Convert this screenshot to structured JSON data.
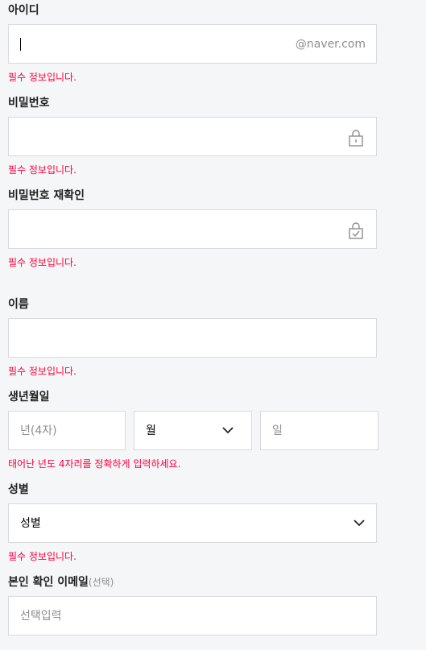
{
  "id_field": {
    "label": "아이디",
    "suffix": "@naver.com",
    "error": "필수 정보입니다."
  },
  "password_field": {
    "label": "비밀번호",
    "icon": "lock-icon",
    "error": "필수 정보입니다."
  },
  "password_confirm_field": {
    "label": "비밀번호 재확인",
    "icon": "lock-check-icon",
    "error": "필수 정보입니다."
  },
  "name_field": {
    "label": "이름",
    "error": "필수 정보입니다."
  },
  "birth_field": {
    "label": "생년월일",
    "year_placeholder": "년(4자)",
    "month_value": "월",
    "day_placeholder": "일",
    "error": "태어난 년도 4자리를 정확하게 입력하세요."
  },
  "gender_field": {
    "label": "성별",
    "value": "성별",
    "error": "필수 정보입니다."
  },
  "email_field": {
    "label": "본인 확인 이메일",
    "optional": "(선택)",
    "placeholder": "선택입력"
  },
  "colors": {
    "error": "#ff003e",
    "background": "#f5f6f7",
    "border": "#dadada"
  }
}
